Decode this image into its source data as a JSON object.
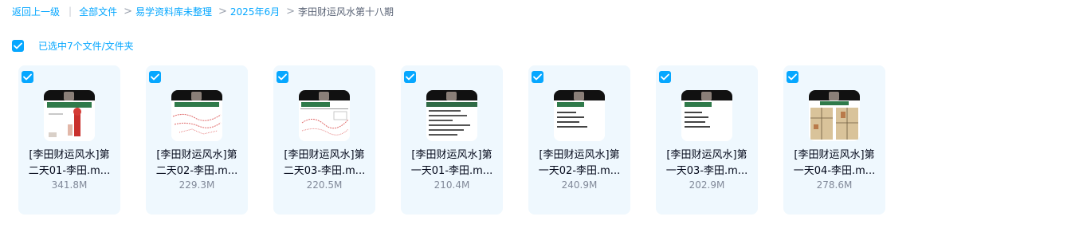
{
  "breadcrumb": {
    "back": "返回上一级",
    "root": "全部文件",
    "level1": "易学资料库未整理",
    "level2": "2025年6月",
    "current": "李田财运风水第十八期",
    "separator_bar": "|",
    "separator_chevron": ">"
  },
  "selection": {
    "label": "已选中7个文件/文件夹",
    "checked": true
  },
  "accent_color": "#06a7ff",
  "files": [
    {
      "name_line1": "[李田财运风水]第",
      "name_line2": "二天01-李田.m...",
      "size": "341.8M",
      "thumb": "slide-red-object",
      "checked": true
    },
    {
      "name_line1": "[李田财运风水]第",
      "name_line2": "二天02-李田.m...",
      "size": "229.3M",
      "thumb": "slide-red-diagram",
      "checked": true
    },
    {
      "name_line1": "[李田财运风水]第",
      "name_line2": "二天03-李田.m...",
      "size": "220.5M",
      "thumb": "slide-chart",
      "checked": true
    },
    {
      "name_line1": "[李田财运风水]第",
      "name_line2": "一天01-李田.m...",
      "size": "210.4M",
      "thumb": "slide-green-header-text",
      "checked": true
    },
    {
      "name_line1": "[李田财运风水]第",
      "name_line2": "一天02-李田.m...",
      "size": "240.9M",
      "thumb": "slide-text",
      "checked": true
    },
    {
      "name_line1": "[李田财运风水]第",
      "name_line2": "一天03-李田.m...",
      "size": "202.9M",
      "thumb": "slide-text",
      "checked": true
    },
    {
      "name_line1": "[李田财运风水]第",
      "name_line2": "一天04-李田.m...",
      "size": "278.6M",
      "thumb": "slide-floorplan",
      "checked": true
    }
  ]
}
